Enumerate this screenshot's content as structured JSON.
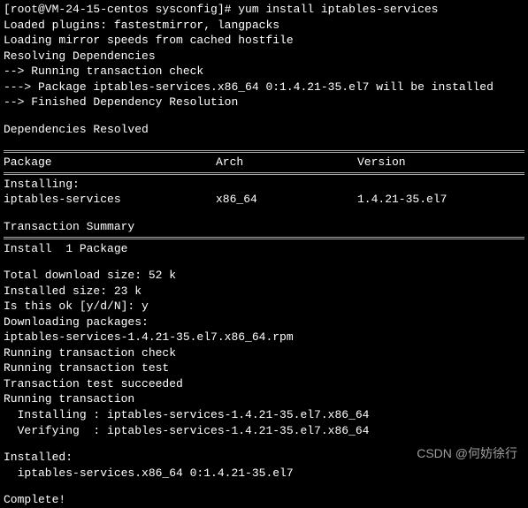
{
  "prompt_line": "[root@VM-24-15-centos sysconfig]# yum install iptables-services",
  "plugins_line": "Loaded plugins: fastestmirror, langpacks",
  "mirror_line": "Loading mirror speeds from cached hostfile",
  "resolving_line": "Resolving Dependencies",
  "check_line": "--> Running transaction check",
  "package_line": "---> Package iptables-services.x86_64 0:1.4.21-35.el7 will be installed",
  "finished_line": "--> Finished Dependency Resolution",
  "deps_resolved": "Dependencies Resolved",
  "headers": {
    "package": " Package",
    "arch": "Arch",
    "version": "Version"
  },
  "installing_label": "Installing:",
  "row": {
    "package": " iptables-services",
    "arch": "x86_64",
    "version": "1.4.21-35.el7"
  },
  "transaction_summary": "Transaction Summary",
  "install_count": "Install  1 Package",
  "download_size": "Total download size: 52 k",
  "installed_size": "Installed size: 23 k",
  "confirm": "Is this ok [y/d/N]: y",
  "downloading": "Downloading packages:",
  "rpm_file": "iptables-services-1.4.21-35.el7.x86_64.rpm",
  "run_check": "Running transaction check",
  "run_test": "Running transaction test",
  "test_succeeded": "Transaction test succeeded",
  "run_transaction": "Running transaction",
  "installing_pkg": "  Installing : iptables-services-1.4.21-35.el7.x86_64",
  "verifying_pkg": "  Verifying  : iptables-services-1.4.21-35.el7.x86_64",
  "installed_label": "Installed:",
  "installed_pkg": "  iptables-services.x86_64 0:1.4.21-35.el7",
  "complete": "Complete!",
  "watermark": "CSDN @何妨徐行"
}
